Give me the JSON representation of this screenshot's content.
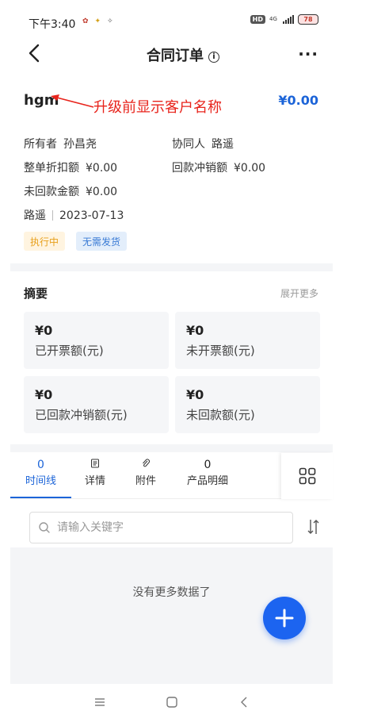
{
  "status_bar": {
    "time": "下午3:40",
    "network": "4G",
    "hd": "HD",
    "battery": "78"
  },
  "header": {
    "title": "合同订单",
    "more": "···"
  },
  "contract": {
    "customer_name": "hgm",
    "annotation": "升级前显示客户名称",
    "amount": "¥0.00",
    "owner_label": "所有者",
    "owner_value": "孙昌尧",
    "collaborator_label": "协同人",
    "collaborator_value": "路遥",
    "discount_label": "整单折扣额",
    "discount_value": "¥0.00",
    "writeoff_label": "回款冲销额",
    "writeoff_value": "¥0.00",
    "unpaid_label": "未回款金额",
    "unpaid_value": "¥0.00",
    "creator": "路遥",
    "date": "2023-07-13",
    "tags": [
      "执行中",
      "无需发货"
    ]
  },
  "summary": {
    "title": "摘要",
    "expand_label": "展开更多",
    "cards": [
      {
        "value": "¥0",
        "label": "已开票额(元)"
      },
      {
        "value": "¥0",
        "label": "未开票额(元)"
      },
      {
        "value": "¥0",
        "label": "已回款冲销额(元)"
      },
      {
        "value": "¥0",
        "label": "未回款额(元)"
      }
    ]
  },
  "tabs": [
    {
      "count": "0",
      "label": "时间线",
      "active": true
    },
    {
      "icon": "document-icon",
      "label": "详情"
    },
    {
      "icon": "paperclip-icon",
      "label": "附件"
    },
    {
      "count": "0",
      "label": "产品明细"
    }
  ],
  "search": {
    "placeholder": "请输入关键字"
  },
  "list": {
    "empty_text": "没有更多数据了"
  },
  "colors": {
    "accent": "#1c64d8",
    "annotation": "#e8241c",
    "tag_running_text": "#e8a01c",
    "tag_ship_text": "#3a7bd5"
  }
}
